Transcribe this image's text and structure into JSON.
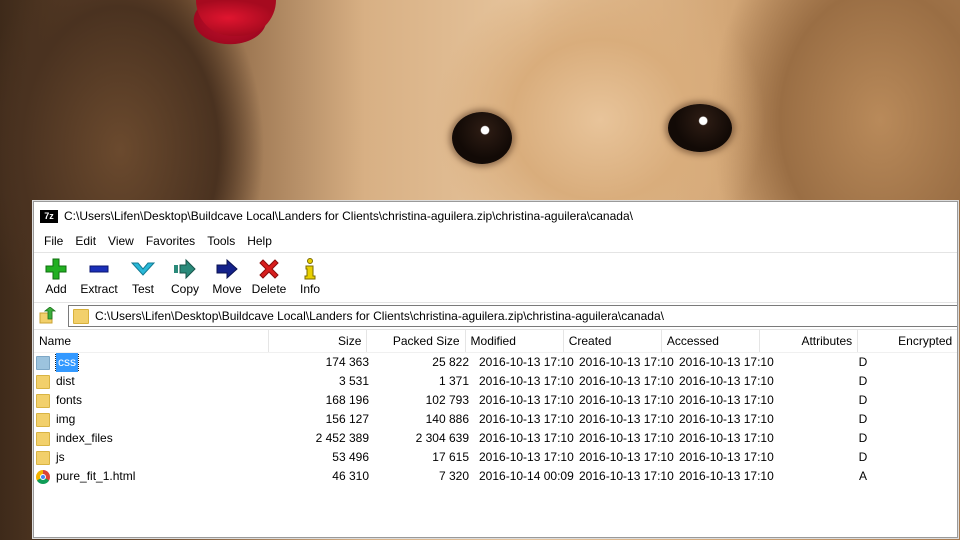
{
  "window": {
    "title": "C:\\Users\\Lifen\\Desktop\\Buildcave Local\\Landers for Clients\\christina-aguilera.zip\\christina-aguilera\\canada\\",
    "app_icon_text": "7z"
  },
  "menu": [
    "File",
    "Edit",
    "View",
    "Favorites",
    "Tools",
    "Help"
  ],
  "toolbar": [
    {
      "label": "Add",
      "icon": "plus-icon",
      "color": "#22b022"
    },
    {
      "label": "Extract",
      "icon": "minus-icon",
      "color": "#1a2fb8"
    },
    {
      "label": "Test",
      "icon": "check-chevron-icon",
      "color": "#29b8d8"
    },
    {
      "label": "Copy",
      "icon": "copy-arrow-icon",
      "color": "#2a8a7a"
    },
    {
      "label": "Move",
      "icon": "move-arrow-icon",
      "color": "#14228a"
    },
    {
      "label": "Delete",
      "icon": "x-icon",
      "color": "#d81e1e"
    },
    {
      "label": "Info",
      "icon": "info-icon",
      "color": "#e8d000"
    }
  ],
  "address": {
    "path": "C:\\Users\\Lifen\\Desktop\\Buildcave Local\\Landers for Clients\\christina-aguilera.zip\\christina-aguilera\\canada\\"
  },
  "columns": {
    "name": "Name",
    "size": "Size",
    "packed": "Packed Size",
    "modified": "Modified",
    "created": "Created",
    "accessed": "Accessed",
    "attributes": "Attributes",
    "encrypted": "Encrypted"
  },
  "rows": [
    {
      "name": "css",
      "type": "folder",
      "selected": true,
      "size": "174 363",
      "packed": "25 822",
      "modified": "2016-10-13 17:10",
      "created": "2016-10-13 17:10",
      "accessed": "2016-10-13 17:10",
      "attr": "D"
    },
    {
      "name": "dist",
      "type": "folder",
      "size": "3 531",
      "packed": "1 371",
      "modified": "2016-10-13 17:10",
      "created": "2016-10-13 17:10",
      "accessed": "2016-10-13 17:10",
      "attr": "D"
    },
    {
      "name": "fonts",
      "type": "folder",
      "size": "168 196",
      "packed": "102 793",
      "modified": "2016-10-13 17:10",
      "created": "2016-10-13 17:10",
      "accessed": "2016-10-13 17:10",
      "attr": "D"
    },
    {
      "name": "img",
      "type": "folder",
      "size": "156 127",
      "packed": "140 886",
      "modified": "2016-10-13 17:10",
      "created": "2016-10-13 17:10",
      "accessed": "2016-10-13 17:10",
      "attr": "D"
    },
    {
      "name": "index_files",
      "type": "folder",
      "size": "2 452 389",
      "packed": "2 304 639",
      "modified": "2016-10-13 17:10",
      "created": "2016-10-13 17:10",
      "accessed": "2016-10-13 17:10",
      "attr": "D"
    },
    {
      "name": "js",
      "type": "folder",
      "size": "53 496",
      "packed": "17 615",
      "modified": "2016-10-13 17:10",
      "created": "2016-10-13 17:10",
      "accessed": "2016-10-13 17:10",
      "attr": "D"
    },
    {
      "name": "pure_fit_1.html",
      "type": "chrome-file",
      "size": "46 310",
      "packed": "7 320",
      "modified": "2016-10-14 00:09",
      "created": "2016-10-13 17:10",
      "accessed": "2016-10-13 17:10",
      "attr": "A"
    }
  ]
}
